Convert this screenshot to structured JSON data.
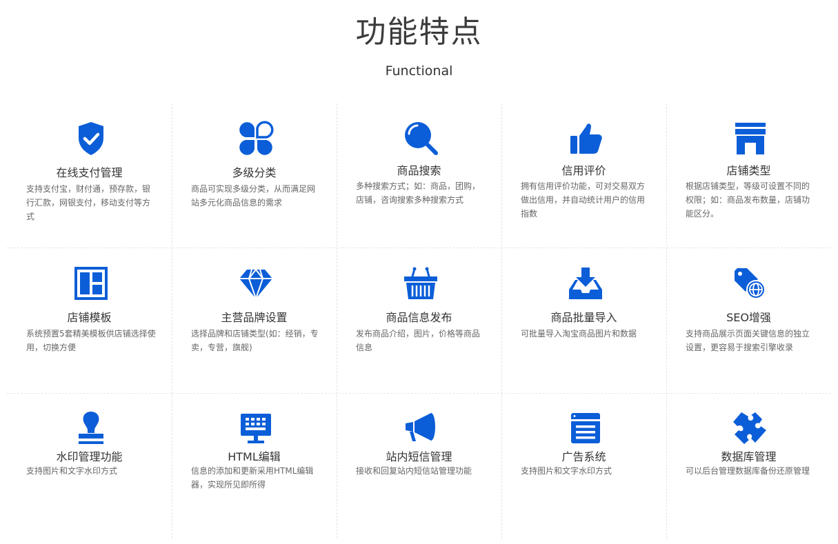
{
  "header": {
    "title": "功能特点",
    "subtitle": "Functional"
  },
  "colors": {
    "icon": "#0b5ed7",
    "title": "#333333",
    "desc": "#666666",
    "divider": "#e2e2e2"
  },
  "features": [
    {
      "icon": "shield-check-icon",
      "title": "在线支付管理",
      "desc": "支持支付宝，财付通，预存款，银行汇款，网银支付，移动支付等方式"
    },
    {
      "icon": "clover-category-icon",
      "title": "多级分类",
      "desc": "商品可实现多级分类，从而满足网站多元化商品信息的需求"
    },
    {
      "icon": "magnifier-icon",
      "title": "商品搜索",
      "desc": "多种搜索方式；如：商品，团购，店铺，咨询搜索多种搜索方式"
    },
    {
      "icon": "thumbs-up-icon",
      "title": "信用评价",
      "desc": "拥有信用评价功能，可对交易双方做出信用，并自动统计用户的信用指数"
    },
    {
      "icon": "storefront-icon",
      "title": "店铺类型",
      "desc": "根据店铺类型，等级可设置不同的权限；如：商品发布数量，店铺功能区分。"
    },
    {
      "icon": "layout-template-icon",
      "title": "店铺模板",
      "desc": "系统预置5套精美模板供店铺选择使用，切换方便"
    },
    {
      "icon": "diamond-icon",
      "title": "主营品牌设置",
      "desc": "选择品牌和店铺类型(如：经销，专卖，专营，旗舰)"
    },
    {
      "icon": "basket-icon",
      "title": "商品信息发布",
      "desc": "发布商品介绍，图片，价格等商品信息"
    },
    {
      "icon": "download-tray-icon",
      "title": "商品批量导入",
      "desc": "可批量导入淘宝商品图片和数据"
    },
    {
      "icon": "tag-globe-icon",
      "title": "SEO增强",
      "desc": "支持商品展示页面关键信息的独立设置，更容易于搜索引擎收录"
    },
    {
      "icon": "stamp-icon",
      "title": "水印管理功能",
      "desc": "支持图片和文字水印方式"
    },
    {
      "icon": "monitor-keyboard-icon",
      "title": "HTML编辑",
      "desc": "信息的添加和更新采用HTML编辑器，实现所见即所得"
    },
    {
      "icon": "megaphone-icon",
      "title": "站内短信管理",
      "desc": "接收和回复站内短信站管理功能"
    },
    {
      "icon": "ad-list-icon",
      "title": "广告系统",
      "desc": "支持图片和文字水印方式"
    },
    {
      "icon": "puzzle-icon",
      "title": "数据库管理",
      "desc": "可以后台管理数据库备份还原管理"
    }
  ]
}
